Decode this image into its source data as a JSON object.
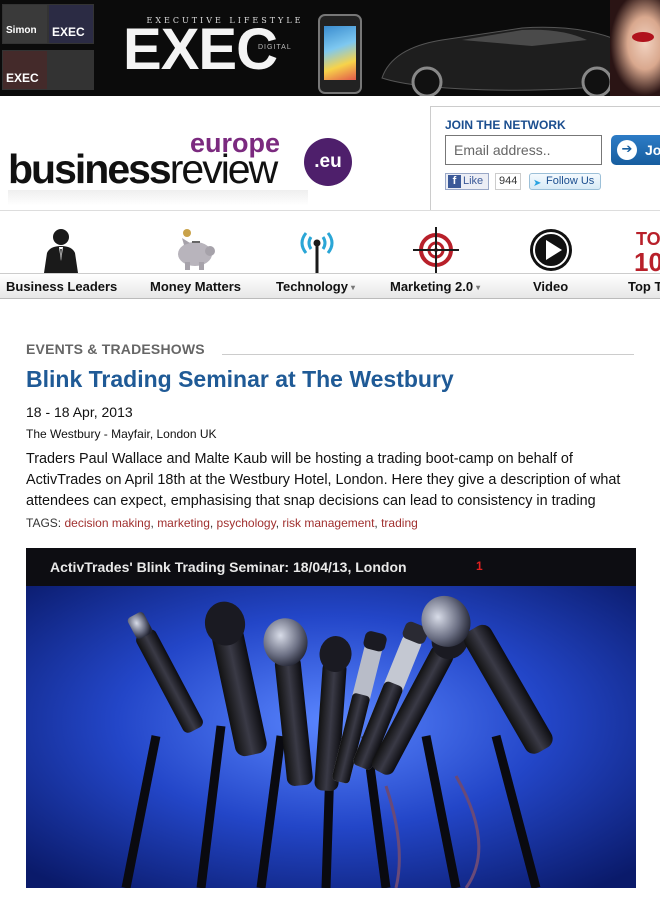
{
  "banner": {
    "tagline": "EXECUTIVE LIFESTYLE",
    "brand": "EXEC",
    "digital": "DIGITAL",
    "covers": [
      "Simon",
      "EXEC",
      "EXEC"
    ]
  },
  "logo": {
    "europe": "europe",
    "business": "business",
    "review": "review",
    "tld": ".eu"
  },
  "network": {
    "title": "JOIN THE NETWORK",
    "email_placeholder": "Email address..",
    "join_label": "Jo",
    "like_label": "Like",
    "like_count": "944",
    "follow_label": "Follow Us"
  },
  "nav": {
    "items": [
      {
        "label": "Business Leaders",
        "icon": "businessman-icon",
        "dropdown": false
      },
      {
        "label": "Money Matters",
        "icon": "piggy-bank-icon",
        "dropdown": false
      },
      {
        "label": "Technology",
        "icon": "antenna-icon",
        "dropdown": true
      },
      {
        "label": "Marketing 2.0",
        "icon": "target-icon",
        "dropdown": true
      },
      {
        "label": "Video",
        "icon": "play-icon",
        "dropdown": false
      },
      {
        "label": "Top T",
        "icon": "top-10-icon",
        "dropdown": false
      }
    ],
    "top_icon_text": "TO",
    "top_icon_digits": "10",
    "caret": "▾"
  },
  "article": {
    "section": "EVENTS & TRADESHOWS",
    "title": "Blink Trading Seminar at The Westbury",
    "dates": "18 - 18 Apr, 2013",
    "location": "The Westbury - Mayfair, London UK",
    "summary": "Traders Paul Wallace and Malte Kaub will be hosting a trading boot-camp on behalf of ActivTrades on April 18th at the Westbury Hotel, London. Here they give a description of what attendees can expect, emphasising that snap decisions can lead to consistency in trading",
    "tags_label": "TAGS:",
    "tags": [
      "decision making",
      "marketing",
      "psychology",
      "risk management",
      "trading"
    ]
  },
  "video": {
    "title": "ActivTrades' Blink Trading Seminar: 18/04/13, London",
    "count": "1"
  },
  "colors": {
    "brand_purple": "#7b2a7f",
    "link_blue": "#1f5a96",
    "tag_red": "#a0302f",
    "join_blue": "#175e9f"
  }
}
